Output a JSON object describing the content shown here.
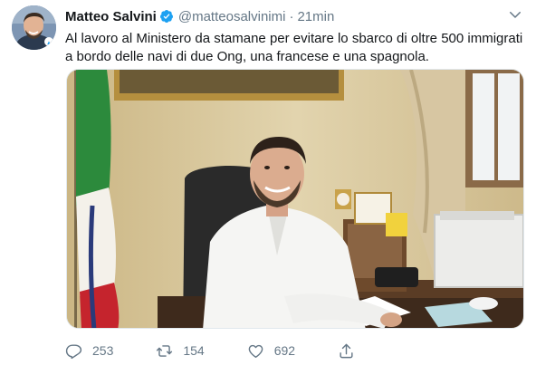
{
  "tweet": {
    "author_name": "Matteo Salvini",
    "handle": "@matteosalvinimi",
    "separator": "·",
    "time": "21min",
    "text": "Al lavoro al Ministero da stamane per evitare lo sbarco di oltre 500 immigrati a bordo delle navi di due Ong, una francese e una spagnola.",
    "verified_icon": "verified-badge-icon",
    "accent_color": "#1da1f2"
  },
  "actions": {
    "reply_count": "253",
    "retweet_count": "154",
    "like_count": "692",
    "icons": [
      "reply-icon",
      "retweet-icon",
      "like-icon",
      "share-icon"
    ]
  }
}
